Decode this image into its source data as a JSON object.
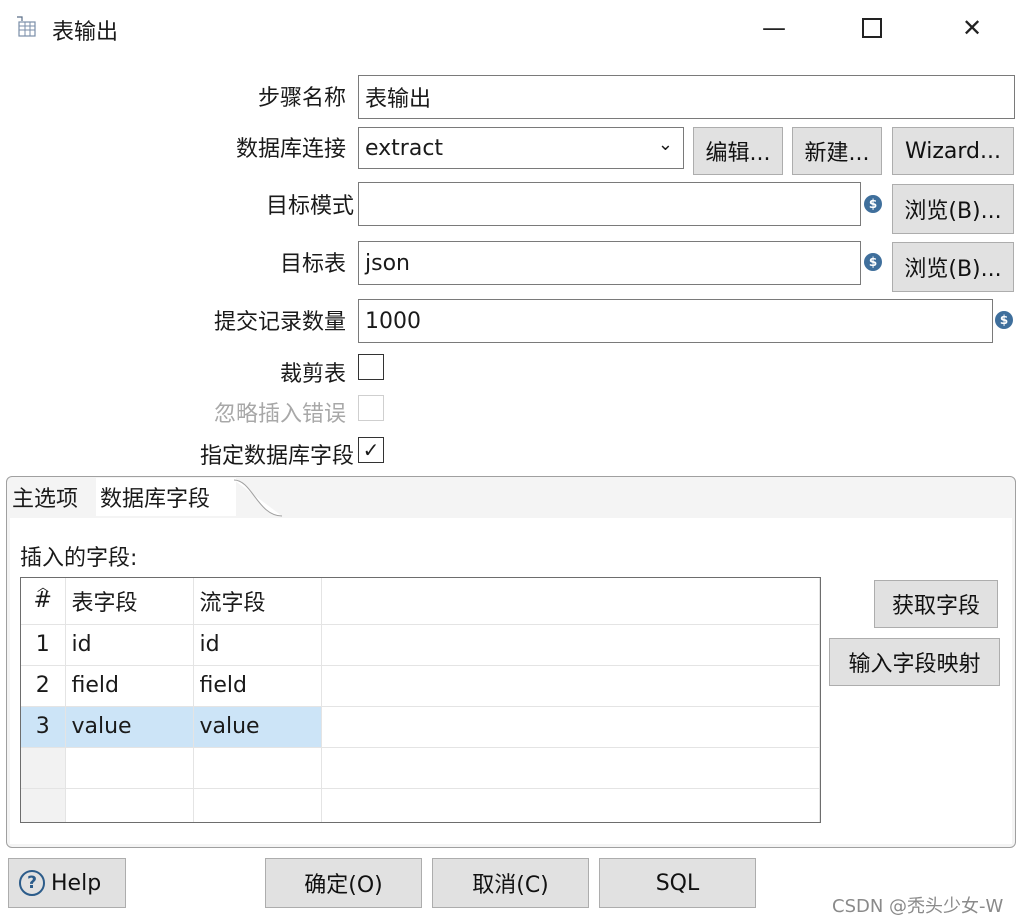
{
  "window": {
    "title": "表输出",
    "icon": "table-output-icon",
    "minimize": "—",
    "maximize": "☐",
    "close": "✕"
  },
  "form": {
    "step_name_label": "步骤名称",
    "step_name_value": "表输出",
    "db_conn_label": "数据库连接",
    "db_conn_value": "extract",
    "edit_btn": "编辑...",
    "new_btn": "新建...",
    "wizard_btn": "Wizard...",
    "schema_label": "目标模式",
    "schema_value": "",
    "browse_btn": "浏览(B)...",
    "table_label": "目标表",
    "table_value": "json",
    "commit_label": "提交记录数量",
    "commit_value": "1000",
    "truncate_label": "裁剪表",
    "truncate_checked": false,
    "ignore_errors_label": "忽略插入错误",
    "ignore_errors_checked": false,
    "specify_fields_label": "指定数据库字段",
    "specify_fields_checked": true,
    "variable_icon": "$"
  },
  "tabs": [
    {
      "label": "主选项",
      "active": false
    },
    {
      "label": "数据库字段",
      "active": true
    }
  ],
  "fields_tab": {
    "section_label": "插入的字段:",
    "columns": [
      "#",
      "表字段",
      "流字段"
    ],
    "rows": [
      {
        "num": "1",
        "table_field": "id",
        "stream_field": "id",
        "selected": false
      },
      {
        "num": "2",
        "table_field": "field",
        "stream_field": "field",
        "selected": false
      },
      {
        "num": "3",
        "table_field": "value",
        "stream_field": "value",
        "selected": true
      }
    ],
    "get_fields_btn": "获取字段",
    "input_mapping_btn": "输入字段映射"
  },
  "footer": {
    "help_btn": "Help",
    "ok_btn": "确定(O)",
    "cancel_btn": "取消(C)",
    "sql_btn": "SQL"
  },
  "watermark": "CSDN @秃头少女-W"
}
